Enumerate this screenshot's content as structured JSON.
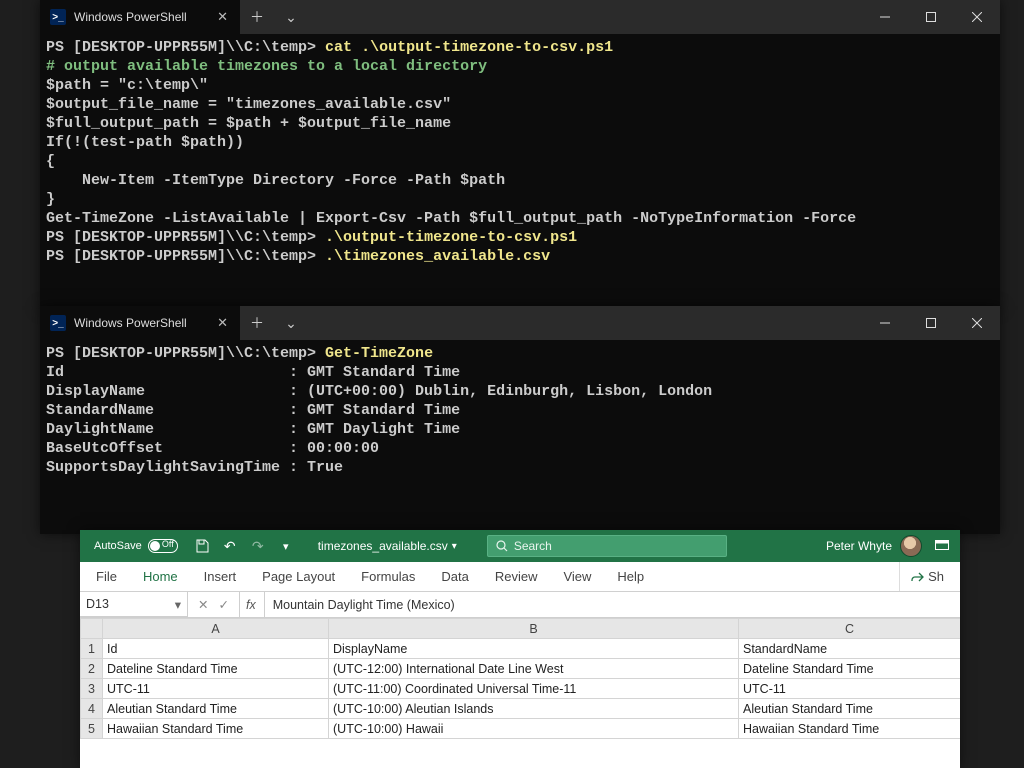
{
  "term1": {
    "tab_title": "Windows PowerShell",
    "lines": [
      {
        "segs": [
          {
            "t": "PS [DESKTOP-UPPR55M]\\\\C:\\temp> ",
            "c": "prompt"
          },
          {
            "t": "cat ",
            "c": "cmd-yellow"
          },
          {
            "t": ".\\output-timezone-to-csv.ps1",
            "c": "cmd-yellow"
          }
        ]
      },
      {
        "segs": [
          {
            "t": "# output available timezones to a local directory",
            "c": "out-green"
          }
        ]
      },
      {
        "segs": [
          {
            "t": "$path = \"c:\\temp\\\"",
            "c": "prompt"
          }
        ]
      },
      {
        "segs": [
          {
            "t": "$output_file_name = \"timezones_available.csv\"",
            "c": "prompt"
          }
        ]
      },
      {
        "segs": [
          {
            "t": "$full_output_path = $path + $output_file_name",
            "c": "prompt"
          }
        ]
      },
      {
        "segs": [
          {
            "t": "",
            "c": "prompt"
          }
        ]
      },
      {
        "segs": [
          {
            "t": "If(!(test-path $path))",
            "c": "prompt"
          }
        ]
      },
      {
        "segs": [
          {
            "t": "{",
            "c": "prompt"
          }
        ]
      },
      {
        "segs": [
          {
            "t": "    New-Item -ItemType Directory -Force -Path $path",
            "c": "prompt"
          }
        ]
      },
      {
        "segs": [
          {
            "t": "}",
            "c": "prompt"
          }
        ]
      },
      {
        "segs": [
          {
            "t": "Get-TimeZone -ListAvailable | Export-Csv -Path $full_output_path -NoTypeInformation -Force",
            "c": "prompt"
          }
        ]
      },
      {
        "segs": [
          {
            "t": "PS [DESKTOP-UPPR55M]\\\\C:\\temp> ",
            "c": "prompt"
          },
          {
            "t": ".\\output-timezone-to-csv.ps1",
            "c": "cmd-yellow"
          }
        ]
      },
      {
        "segs": [
          {
            "t": "PS [DESKTOP-UPPR55M]\\\\C:\\temp> ",
            "c": "prompt"
          },
          {
            "t": ".\\timezones_available.csv",
            "c": "cmd-yellow"
          }
        ]
      }
    ]
  },
  "term2": {
    "tab_title": "Windows PowerShell",
    "lines": [
      {
        "segs": [
          {
            "t": "PS [DESKTOP-UPPR55M]\\\\C:\\temp> ",
            "c": "prompt"
          },
          {
            "t": "Get-TimeZone",
            "c": "cmd-yellow"
          }
        ]
      },
      {
        "segs": [
          {
            "t": "",
            "c": "prompt"
          }
        ]
      },
      {
        "segs": [
          {
            "t": "",
            "c": "prompt"
          }
        ]
      },
      {
        "segs": [
          {
            "t": "Id                         : GMT Standard Time",
            "c": "prompt"
          }
        ]
      },
      {
        "segs": [
          {
            "t": "DisplayName                : (UTC+00:00) Dublin, Edinburgh, Lisbon, London",
            "c": "prompt"
          }
        ]
      },
      {
        "segs": [
          {
            "t": "StandardName               : GMT Standard Time",
            "c": "prompt"
          }
        ]
      },
      {
        "segs": [
          {
            "t": "DaylightName               : GMT Daylight Time",
            "c": "prompt"
          }
        ]
      },
      {
        "segs": [
          {
            "t": "BaseUtcOffset              : 00:00:00",
            "c": "prompt"
          }
        ]
      },
      {
        "segs": [
          {
            "t": "SupportsDaylightSavingTime : True",
            "c": "prompt"
          }
        ]
      }
    ]
  },
  "excel": {
    "autosave_label": "AutoSave",
    "autosave_state": "Off",
    "filename": "timezones_available.csv",
    "search_placeholder": "Search",
    "user_name": "Peter Whyte",
    "ribbon_tabs": [
      "File",
      "Home",
      "Insert",
      "Page Layout",
      "Formulas",
      "Data",
      "Review",
      "View",
      "Help"
    ],
    "share_label": "Sh",
    "name_box": "D13",
    "fx_label": "fx",
    "formula_value": "Mountain Daylight Time (Mexico)",
    "columns": [
      "A",
      "B",
      "C"
    ],
    "header_row": [
      "Id",
      "DisplayName",
      "StandardName"
    ],
    "rows": [
      [
        "Dateline Standard Time",
        "(UTC-12:00) International Date Line West",
        "Dateline Standard Time"
      ],
      [
        "UTC-11",
        "(UTC-11:00) Coordinated Universal Time-11",
        "UTC-11"
      ],
      [
        "Aleutian Standard Time",
        "(UTC-10:00) Aleutian Islands",
        "Aleutian Standard Time"
      ],
      [
        "Hawaiian Standard Time",
        "(UTC-10:00) Hawaii",
        "Hawaiian Standard Time"
      ]
    ]
  }
}
